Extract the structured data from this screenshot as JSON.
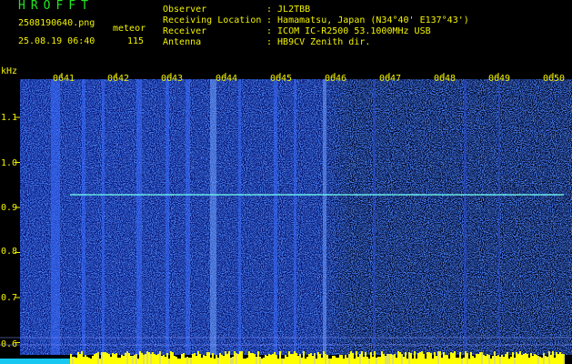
{
  "header": {
    "title": "HROFFT",
    "filename": "2508190640.png",
    "datetime": "25.08.19 06:40",
    "mode_label": "meteor",
    "count": "115",
    "fields": [
      {
        "key": "Observer",
        "value": ": JL2TBB"
      },
      {
        "key": "Receiving Location",
        "value": ": Hamamatsu, Japan (N34°40' E137°43')"
      },
      {
        "key": "Receiver",
        "value": ": ICOM IC-R2500 53.1000MHz USB"
      },
      {
        "key": "Antenna",
        "value": ": HB9CV Zenith dir."
      }
    ]
  },
  "spectrogram": {
    "y_unit": "kHz",
    "y_ticks": [
      "1.1",
      "1.0",
      "0.9",
      "0.8",
      "0.7",
      "0.6"
    ],
    "x_ticks": [
      "0641",
      "0642",
      "0643",
      "0644",
      "0645",
      "0646",
      "0647",
      "0648",
      "0649",
      "0650"
    ],
    "colors": {
      "background": "#000000",
      "noise": "#1b2fc8",
      "carrier": "#66e6e6",
      "axis_text": "#f2f200",
      "bottom_bar": "#ffff00"
    }
  }
}
